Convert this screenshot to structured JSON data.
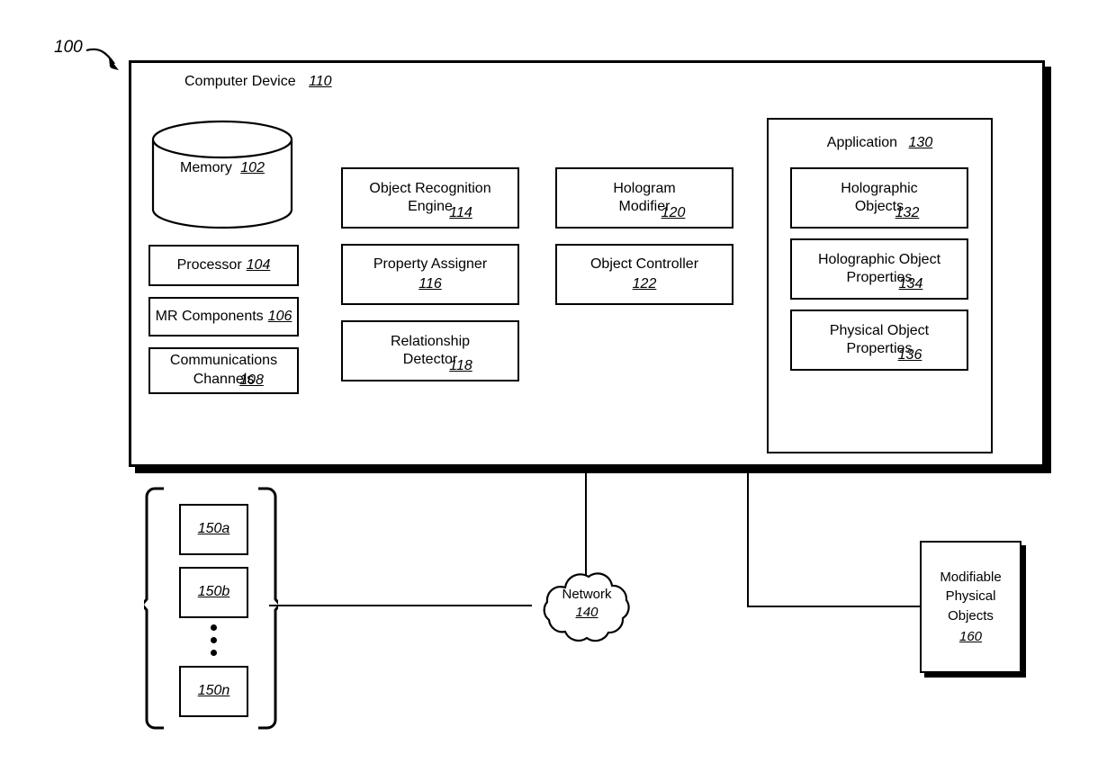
{
  "figure": {
    "reference_numeral": "100",
    "arrow_icon": "curved-arrow-icon"
  },
  "computer_device": {
    "title": "Computer Device",
    "numeral": "110",
    "memory": {
      "label": "Memory",
      "numeral": "102",
      "shape": "cylinder-icon"
    },
    "left_column": [
      {
        "label": "Processor",
        "numeral": "104",
        "inline": true
      },
      {
        "label": "MR Components",
        "numeral": "106",
        "inline": true
      },
      {
        "label": "Communications\nChannels",
        "numeral": "108",
        "inline": true
      }
    ],
    "middle_column": [
      {
        "label": "Object Recognition\nEngine",
        "numeral": "114",
        "inline": true
      },
      {
        "label": "Property Assigner",
        "numeral": "116",
        "inline": false
      },
      {
        "label": "Relationship\nDetector",
        "numeral": "118",
        "inline": true
      }
    ],
    "right_column": [
      {
        "label": "Hologram\nModifier",
        "numeral": "120",
        "inline": true
      },
      {
        "label": "Object Controller",
        "numeral": "122",
        "inline": false
      }
    ],
    "application": {
      "title": "Application",
      "numeral": "130",
      "items": [
        {
          "label": "Holographic\nObjects",
          "numeral": "132",
          "inline": true
        },
        {
          "label": "Holographic Object\nProperties",
          "numeral": "134",
          "inline": true
        },
        {
          "label": "Physical Object\nProperties",
          "numeral": "136",
          "inline": true
        }
      ]
    }
  },
  "network": {
    "label": "Network",
    "numeral": "140",
    "shape": "cloud-icon"
  },
  "devices_group": {
    "bracket_left_icon": "left-brace-icon",
    "bracket_right_icon": "right-brace-icon",
    "ellipsis_icon": "vertical-ellipsis-icon",
    "items": [
      {
        "numeral": "150a"
      },
      {
        "numeral": "150b"
      },
      {
        "numeral": "150n"
      }
    ]
  },
  "modifiable_physical_objects": {
    "label": "Modifiable\nPhysical\nObjects",
    "numeral": "160"
  },
  "colors": {
    "line": "#000000",
    "background": "#ffffff"
  }
}
